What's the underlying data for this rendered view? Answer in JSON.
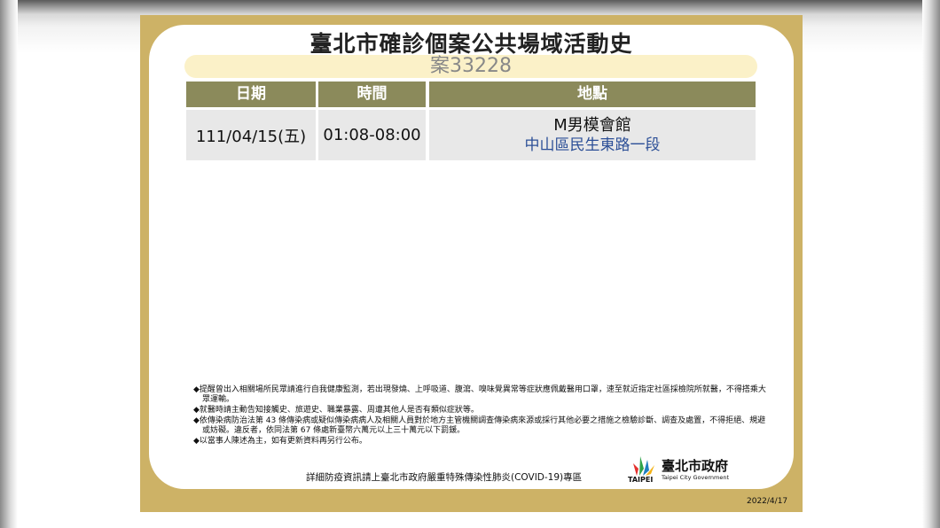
{
  "title": "臺北市確診個案公共場域活動史",
  "case_id": "案33228",
  "table": {
    "headers": [
      "日期",
      "時間",
      "地點"
    ],
    "rows": [
      {
        "date": "111/04/15(五)",
        "time": "01:08-08:00",
        "place_name": "M男模會館",
        "place_address": "中山區民生東路一段"
      }
    ]
  },
  "notes": [
    "◆提醒曾出入相關場所民眾請進行自我健康監測，若出現發燒、上呼吸道、腹瀉、嗅味覺異常等症狀應佩戴醫用口罩，速至就近指定社區採檢院所就醫，不得搭乘大眾運輸。",
    "◆就醫時請主動告知接觸史、旅遊史、職業暴露、周遭其他人是否有類似症狀等。",
    "◆依傳染病防治法第 43 條傳染病或疑似傳染病病人及相關人員對於地方主管機關調查傳染病來源或採行其他必要之措施之檢驗診斷、調查及處置，不得拒絕、規避或妨礙。違反者，依同法第 67 條處新臺幣六萬元以上三十萬元以下罰鍰。",
    "◆以當事人陳述為主，如有更新資料再另行公布。"
  ],
  "footer": "詳細防疫資訊請上臺北市政府嚴重特殊傳染性肺炎(COVID-19)專區",
  "logo": {
    "taipei": "TAIPEI",
    "cn": "臺北市政府",
    "en": "Taipei City Government",
    "icon": "taipei-logo-icon"
  },
  "date_stamp": "2022/4/17",
  "colors": {
    "frame": "#cdb266",
    "header": "#8b8a5b",
    "case_bar": "#fbf1c8",
    "address": "#2c4f97"
  }
}
